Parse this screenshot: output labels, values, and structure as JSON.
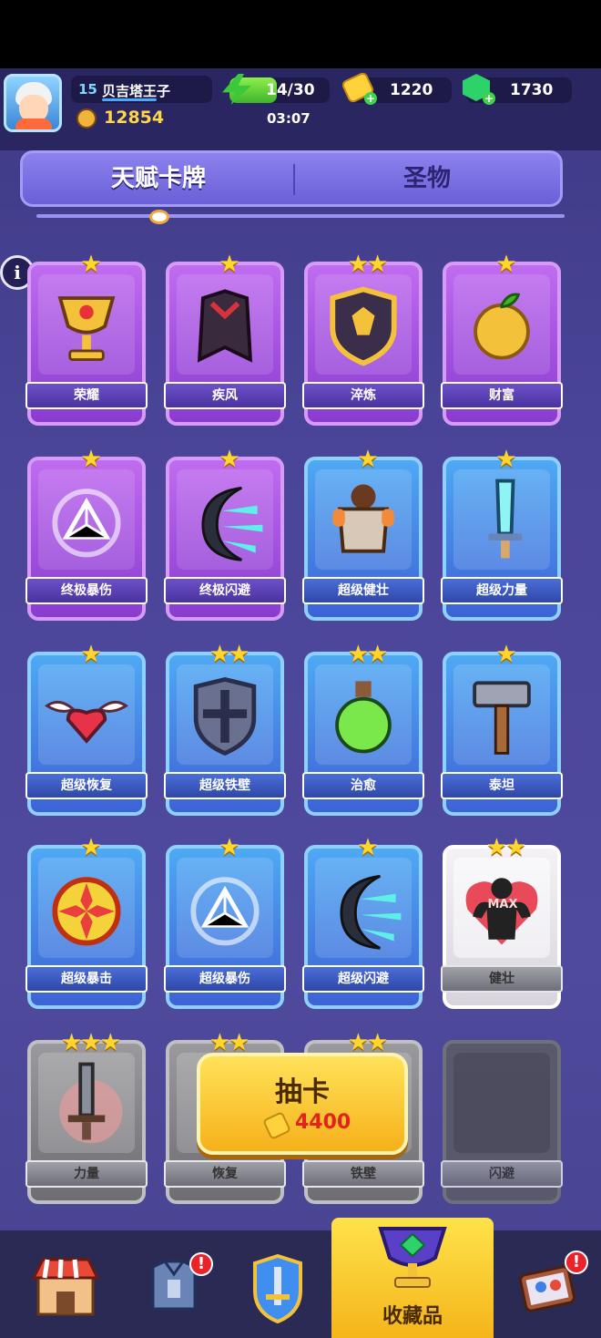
{
  "player": {
    "level": "15",
    "name": "贝吉塔王子",
    "trophies": "12854"
  },
  "resources": {
    "energy": "14/30",
    "energy_fraction": 0.47,
    "timer": "03:07",
    "coins": "1220",
    "gems": "1730"
  },
  "tabs": [
    {
      "label": "天赋卡牌",
      "active": true
    },
    {
      "label": "圣物",
      "active": false
    }
  ],
  "info_icon": "i",
  "cards": [
    {
      "label": "荣耀",
      "stars": "★",
      "style": "purple",
      "icon": "chalice-icon"
    },
    {
      "label": "疾风",
      "stars": "★",
      "style": "purple",
      "icon": "cape-icon"
    },
    {
      "label": "淬炼",
      "stars": "★★",
      "style": "purple",
      "icon": "shield-badge-icon"
    },
    {
      "label": "财富",
      "stars": "★",
      "style": "purple",
      "icon": "golden-apple-icon"
    },
    {
      "label": "终极暴伤",
      "stars": "★",
      "style": "purple",
      "icon": "triangle-sigil-icon"
    },
    {
      "label": "终极闪避",
      "stars": "★",
      "style": "purple",
      "icon": "crescent-icon"
    },
    {
      "label": "超级健壮",
      "stars": "★",
      "style": "blue",
      "icon": "armor-icon"
    },
    {
      "label": "超级力量",
      "stars": "★",
      "style": "blue",
      "icon": "crystal-sword-icon"
    },
    {
      "label": "超级恢复",
      "stars": "★",
      "style": "blue",
      "icon": "winged-heart-icon"
    },
    {
      "label": "超级铁壁",
      "stars": "★★",
      "style": "blue",
      "icon": "cross-shield-icon"
    },
    {
      "label": "治愈",
      "stars": "★★",
      "style": "blue",
      "icon": "potion-icon"
    },
    {
      "label": "泰坦",
      "stars": "★",
      "style": "blue",
      "icon": "hammer-icon"
    },
    {
      "label": "超级暴击",
      "stars": "★",
      "style": "blue",
      "icon": "crosshair-icon"
    },
    {
      "label": "超级暴伤",
      "stars": "★",
      "style": "blue",
      "icon": "triangle-sigil-icon"
    },
    {
      "label": "超级闪避",
      "stars": "★",
      "style": "blue",
      "icon": "crescent-icon"
    },
    {
      "label": "健壮",
      "stars": "★★",
      "style": "white",
      "icon": "muscle-heart-icon",
      "max": "MAX"
    },
    {
      "label": "力量",
      "stars": "★★★",
      "style": "grey",
      "icon": "sword-icon"
    },
    {
      "label": "恢复",
      "stars": "★★",
      "style": "grey",
      "icon": "heart-icon"
    },
    {
      "label": "铁壁",
      "stars": "★★",
      "style": "grey",
      "icon": "shield-icon"
    },
    {
      "label": "闪避",
      "stars": "",
      "style": "empty",
      "icon": "blank-icon"
    }
  ],
  "draw": {
    "title": "抽卡",
    "cost": "4400"
  },
  "nav": {
    "items": [
      {
        "name": "shop",
        "icon": "shop-icon",
        "badge": ""
      },
      {
        "name": "equipment",
        "icon": "armor-icon",
        "badge": "!"
      },
      {
        "name": "hero",
        "icon": "sword-shield-icon",
        "badge": ""
      },
      {
        "name": "collection",
        "icon": "chalice-icon",
        "label": "收藏品"
      },
      {
        "name": "events",
        "icon": "gift-icon",
        "badge": "!"
      }
    ]
  },
  "colors": {
    "accent": "#ffd23c",
    "bg": "#4a4598",
    "purple_card": "#a64fe0",
    "blue_card": "#4588e4"
  }
}
